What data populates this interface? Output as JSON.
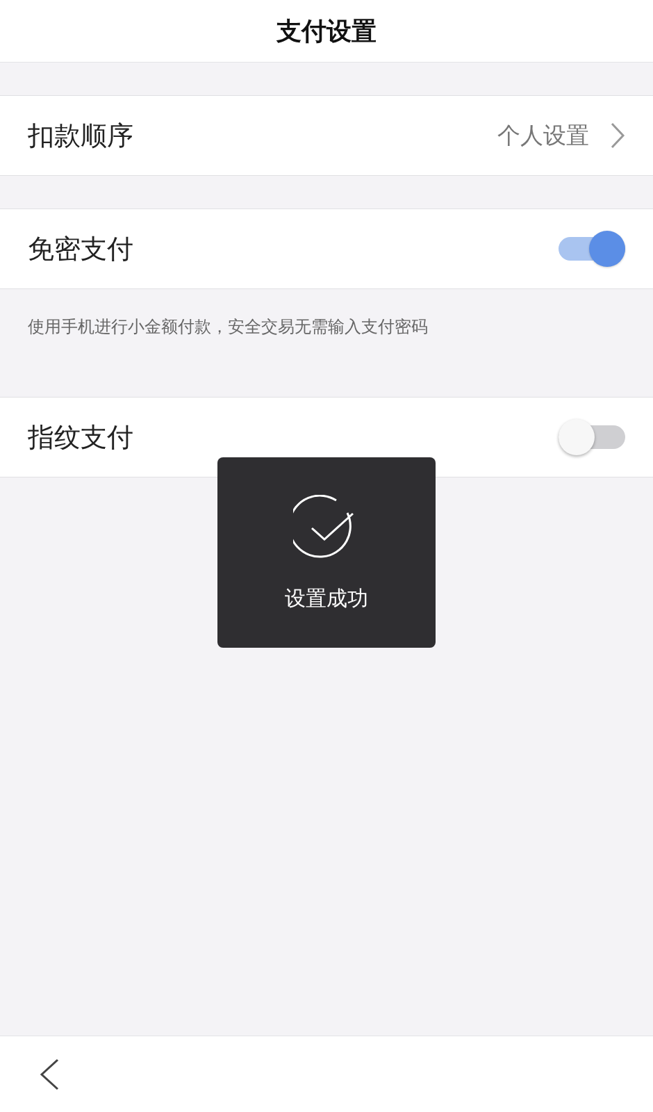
{
  "title": "支付设置",
  "sections": [
    {
      "kind": "link",
      "label": "扣款顺序",
      "value": "个人设置"
    },
    {
      "kind": "toggle",
      "label": "免密支付",
      "on": true,
      "note": "使用手机进行小金额付款，安全交易无需输入支付密码"
    },
    {
      "kind": "toggle",
      "label": "指纹支付",
      "on": false
    }
  ],
  "toast": {
    "message": "设置成功"
  }
}
